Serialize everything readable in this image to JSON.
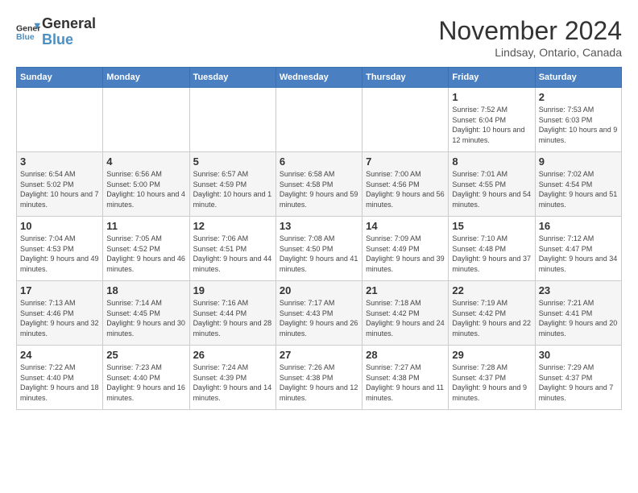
{
  "header": {
    "logo_line1": "General",
    "logo_line2": "Blue",
    "month_title": "November 2024",
    "location": "Lindsay, Ontario, Canada"
  },
  "weekdays": [
    "Sunday",
    "Monday",
    "Tuesday",
    "Wednesday",
    "Thursday",
    "Friday",
    "Saturday"
  ],
  "weeks": [
    [
      {
        "day": "",
        "info": ""
      },
      {
        "day": "",
        "info": ""
      },
      {
        "day": "",
        "info": ""
      },
      {
        "day": "",
        "info": ""
      },
      {
        "day": "",
        "info": ""
      },
      {
        "day": "1",
        "info": "Sunrise: 7:52 AM\nSunset: 6:04 PM\nDaylight: 10 hours and 12 minutes."
      },
      {
        "day": "2",
        "info": "Sunrise: 7:53 AM\nSunset: 6:03 PM\nDaylight: 10 hours and 9 minutes."
      }
    ],
    [
      {
        "day": "3",
        "info": "Sunrise: 6:54 AM\nSunset: 5:02 PM\nDaylight: 10 hours and 7 minutes."
      },
      {
        "day": "4",
        "info": "Sunrise: 6:56 AM\nSunset: 5:00 PM\nDaylight: 10 hours and 4 minutes."
      },
      {
        "day": "5",
        "info": "Sunrise: 6:57 AM\nSunset: 4:59 PM\nDaylight: 10 hours and 1 minute."
      },
      {
        "day": "6",
        "info": "Sunrise: 6:58 AM\nSunset: 4:58 PM\nDaylight: 9 hours and 59 minutes."
      },
      {
        "day": "7",
        "info": "Sunrise: 7:00 AM\nSunset: 4:56 PM\nDaylight: 9 hours and 56 minutes."
      },
      {
        "day": "8",
        "info": "Sunrise: 7:01 AM\nSunset: 4:55 PM\nDaylight: 9 hours and 54 minutes."
      },
      {
        "day": "9",
        "info": "Sunrise: 7:02 AM\nSunset: 4:54 PM\nDaylight: 9 hours and 51 minutes."
      }
    ],
    [
      {
        "day": "10",
        "info": "Sunrise: 7:04 AM\nSunset: 4:53 PM\nDaylight: 9 hours and 49 minutes."
      },
      {
        "day": "11",
        "info": "Sunrise: 7:05 AM\nSunset: 4:52 PM\nDaylight: 9 hours and 46 minutes."
      },
      {
        "day": "12",
        "info": "Sunrise: 7:06 AM\nSunset: 4:51 PM\nDaylight: 9 hours and 44 minutes."
      },
      {
        "day": "13",
        "info": "Sunrise: 7:08 AM\nSunset: 4:50 PM\nDaylight: 9 hours and 41 minutes."
      },
      {
        "day": "14",
        "info": "Sunrise: 7:09 AM\nSunset: 4:49 PM\nDaylight: 9 hours and 39 minutes."
      },
      {
        "day": "15",
        "info": "Sunrise: 7:10 AM\nSunset: 4:48 PM\nDaylight: 9 hours and 37 minutes."
      },
      {
        "day": "16",
        "info": "Sunrise: 7:12 AM\nSunset: 4:47 PM\nDaylight: 9 hours and 34 minutes."
      }
    ],
    [
      {
        "day": "17",
        "info": "Sunrise: 7:13 AM\nSunset: 4:46 PM\nDaylight: 9 hours and 32 minutes."
      },
      {
        "day": "18",
        "info": "Sunrise: 7:14 AM\nSunset: 4:45 PM\nDaylight: 9 hours and 30 minutes."
      },
      {
        "day": "19",
        "info": "Sunrise: 7:16 AM\nSunset: 4:44 PM\nDaylight: 9 hours and 28 minutes."
      },
      {
        "day": "20",
        "info": "Sunrise: 7:17 AM\nSunset: 4:43 PM\nDaylight: 9 hours and 26 minutes."
      },
      {
        "day": "21",
        "info": "Sunrise: 7:18 AM\nSunset: 4:42 PM\nDaylight: 9 hours and 24 minutes."
      },
      {
        "day": "22",
        "info": "Sunrise: 7:19 AM\nSunset: 4:42 PM\nDaylight: 9 hours and 22 minutes."
      },
      {
        "day": "23",
        "info": "Sunrise: 7:21 AM\nSunset: 4:41 PM\nDaylight: 9 hours and 20 minutes."
      }
    ],
    [
      {
        "day": "24",
        "info": "Sunrise: 7:22 AM\nSunset: 4:40 PM\nDaylight: 9 hours and 18 minutes."
      },
      {
        "day": "25",
        "info": "Sunrise: 7:23 AM\nSunset: 4:40 PM\nDaylight: 9 hours and 16 minutes."
      },
      {
        "day": "26",
        "info": "Sunrise: 7:24 AM\nSunset: 4:39 PM\nDaylight: 9 hours and 14 minutes."
      },
      {
        "day": "27",
        "info": "Sunrise: 7:26 AM\nSunset: 4:38 PM\nDaylight: 9 hours and 12 minutes."
      },
      {
        "day": "28",
        "info": "Sunrise: 7:27 AM\nSunset: 4:38 PM\nDaylight: 9 hours and 11 minutes."
      },
      {
        "day": "29",
        "info": "Sunrise: 7:28 AM\nSunset: 4:37 PM\nDaylight: 9 hours and 9 minutes."
      },
      {
        "day": "30",
        "info": "Sunrise: 7:29 AM\nSunset: 4:37 PM\nDaylight: 9 hours and 7 minutes."
      }
    ]
  ]
}
